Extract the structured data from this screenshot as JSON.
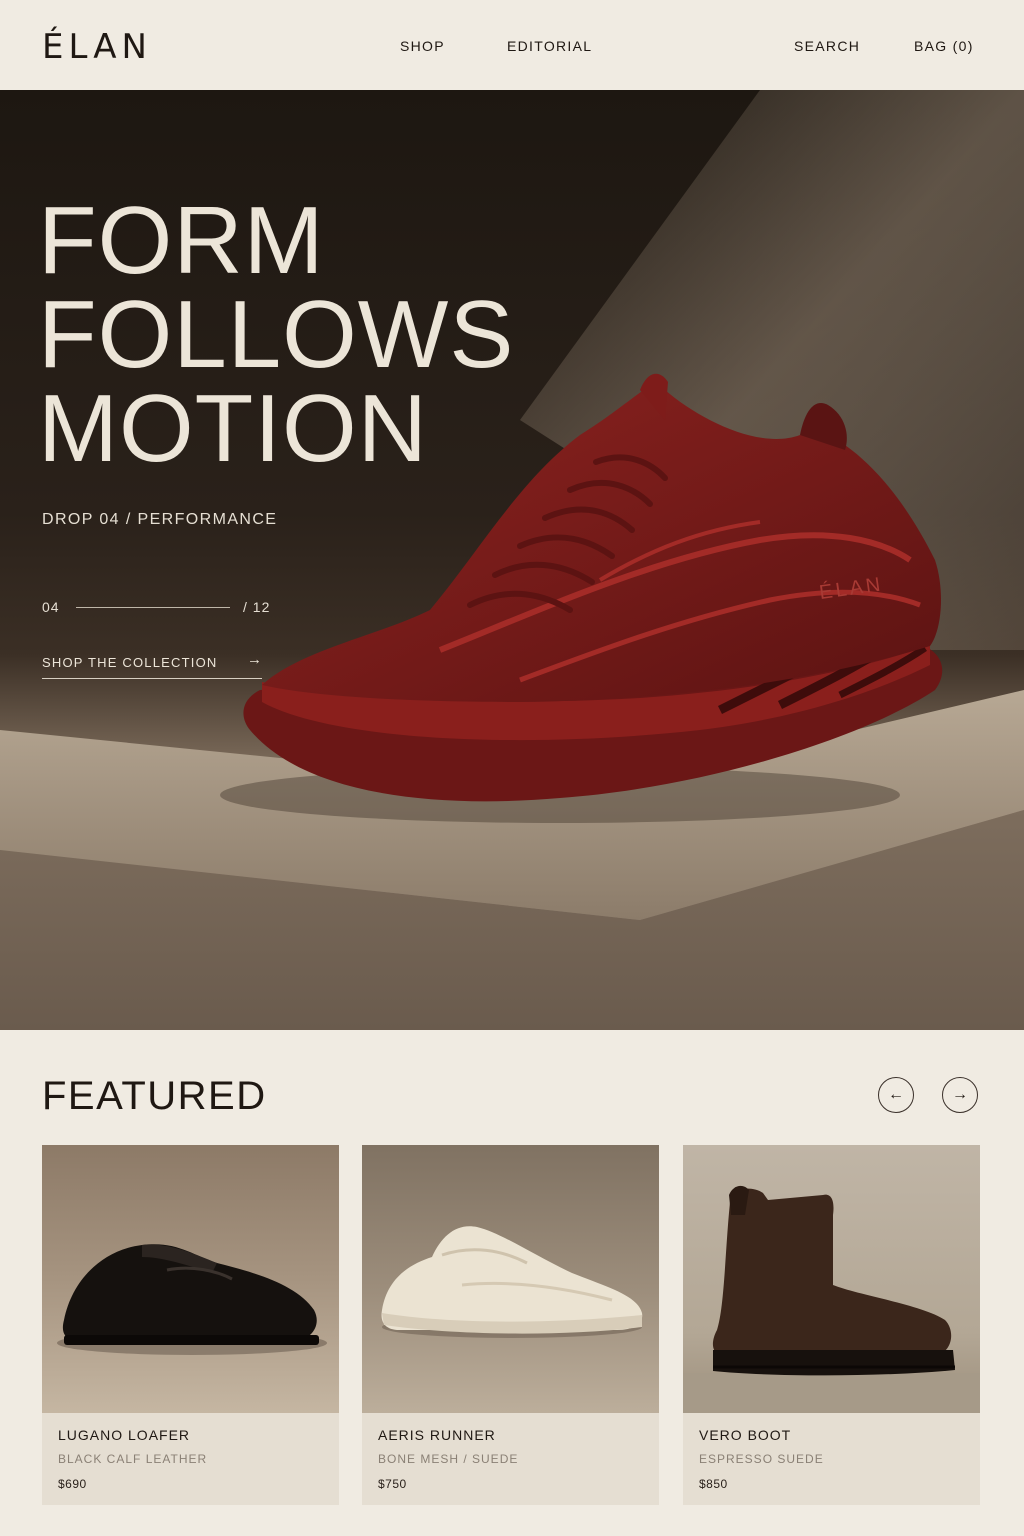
{
  "header": {
    "logo": "ÉLAN",
    "nav_shop": "SHOP",
    "nav_editorial": "EDITORIAL",
    "nav_search": "SEARCH",
    "nav_bag": "BAG (0)"
  },
  "hero": {
    "title": "FORM\nFOLLOWS\nMOTION",
    "drop": "DROP 04 / PERFORMANCE",
    "current": "04",
    "total": "/ 12",
    "progress": 0.333,
    "cta": "SHOP THE COLLECTION",
    "cta_icon": "arrow-right-icon",
    "shoe_brand": "ÉLAN",
    "shoe_color": "#7a1a18"
  },
  "featured": {
    "title": "FEATURED",
    "prev_icon": "arrow-left-icon",
    "next_icon": "arrow-right-icon",
    "products": [
      {
        "name": "LUGANO LOAFER",
        "material": "BLACK CALF LEATHER",
        "price": "$690"
      },
      {
        "name": "AERIS RUNNER",
        "material": "BONE MESH / SUEDE",
        "price": "$750"
      },
      {
        "name": "VERO BOOT",
        "material": "ESPRESSO SUEDE",
        "price": "$850"
      }
    ]
  },
  "colors": {
    "background": "#f0ebe2",
    "text": "#1f1813",
    "hero_dark": "#1d1711",
    "accent_red": "#7a1a18"
  }
}
